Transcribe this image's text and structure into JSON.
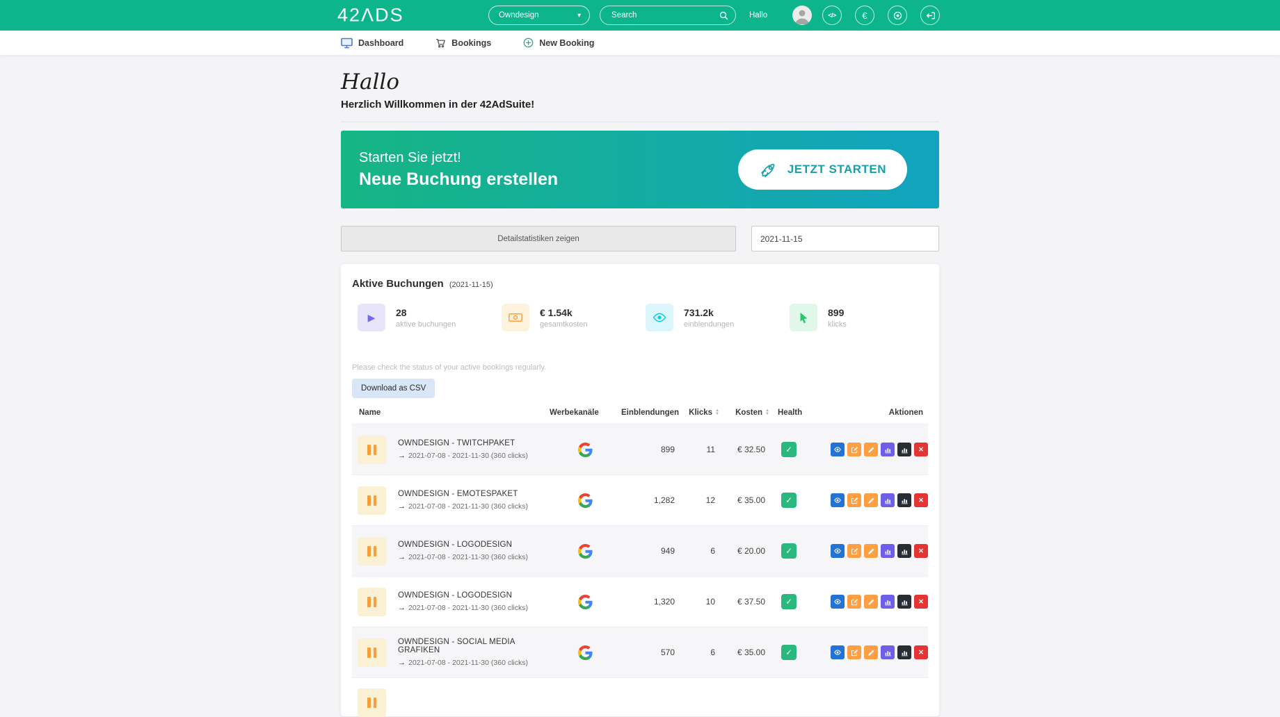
{
  "brand": {
    "logo_text": "42ΛDS"
  },
  "topbar": {
    "client_dropdown_value": "Owndesign",
    "search_placeholder": "Search",
    "greeting": "Hallo"
  },
  "icons": {
    "chevron_down": "▾",
    "code": "</>",
    "euro": "€",
    "play": "▶",
    "check": "✓",
    "close": "✕",
    "sort_up": "▲",
    "sort_down": "▼",
    "arrow_right": "→"
  },
  "nav": {
    "items": [
      {
        "label": "Dashboard"
      },
      {
        "label": "Bookings"
      },
      {
        "label": "New Booking"
      }
    ]
  },
  "welcome": {
    "heading": "Hallo",
    "subheading": "Herzlich Willkommen in der 42AdSuite!"
  },
  "banner": {
    "intro": "Starten Sie jetzt!",
    "title": "Neue Buchung erstellen",
    "cta_label": "JETZT STARTEN"
  },
  "controls": {
    "detail_button_label": "Detailstatistiken zeigen",
    "date_value": "2021-11-15"
  },
  "bookings_panel": {
    "title": "Aktive Buchungen",
    "title_date": "(2021-11-15)",
    "stats": [
      {
        "icon": "play-icon",
        "value": "28",
        "label": "aktive buchungen"
      },
      {
        "icon": "banknote-icon",
        "value": "€ 1.54k",
        "label": "gesamtkosten"
      },
      {
        "icon": "eye-icon",
        "value": "731.2k",
        "label": "einblendungen"
      },
      {
        "icon": "cursor-icon",
        "value": "899",
        "label": "klicks"
      }
    ],
    "note": "Please check the status of your active bookings regularly.",
    "csv_button_label": "Download as CSV",
    "table": {
      "headers": [
        "Name",
        "Werbekanäle",
        "Einblendungen",
        "Klicks",
        "Kosten",
        "Health",
        "Aktionen"
      ],
      "rows": [
        {
          "name": "OWNDESIGN - TWITCHPAKET",
          "period": "2021-07-08 - 2021-11-30 (360 clicks)",
          "channel": "Google",
          "einblendungen": "899",
          "klicks": "11",
          "kosten": "€ 32.50",
          "health": "ok"
        },
        {
          "name": "OWNDESIGN - EMOTESPAKET",
          "period": "2021-07-08 - 2021-11-30 (360 clicks)",
          "channel": "Google",
          "einblendungen": "1,282",
          "klicks": "12",
          "kosten": "€ 35.00",
          "health": "ok"
        },
        {
          "name": "OWNDESIGN - LOGODESIGN",
          "period": "2021-07-08 - 2021-11-30 (360 clicks)",
          "channel": "Google",
          "einblendungen": "949",
          "klicks": "6",
          "kosten": "€ 20.00",
          "health": "ok"
        },
        {
          "name": "OWNDESIGN - LOGODESIGN",
          "period": "2021-07-08 - 2021-11-30 (360 clicks)",
          "channel": "Google",
          "einblendungen": "1,320",
          "klicks": "10",
          "kosten": "€ 37.50",
          "health": "ok"
        },
        {
          "name": "OWNDESIGN - SOCIAL MEDIA GRAFIKEN",
          "period": "2021-07-08 - 2021-11-30 (360 clicks)",
          "channel": "Google",
          "einblendungen": "570",
          "klicks": "6",
          "kosten": "€ 35.00",
          "health": "ok"
        }
      ]
    }
  },
  "colors": {
    "topbar_green": "#0cb58b",
    "banner_gradient_start": "#16b584",
    "banner_gradient_end": "#12a3c0",
    "cta_text": "#16a0aa",
    "primary_purple": "#7367f0",
    "warning_orange": "#ff9f43",
    "info_cyan": "#00cfe8",
    "success_green": "#28c76f",
    "action_blue": "#2273d3",
    "danger_red": "#e43434",
    "dark": "#272d35"
  }
}
